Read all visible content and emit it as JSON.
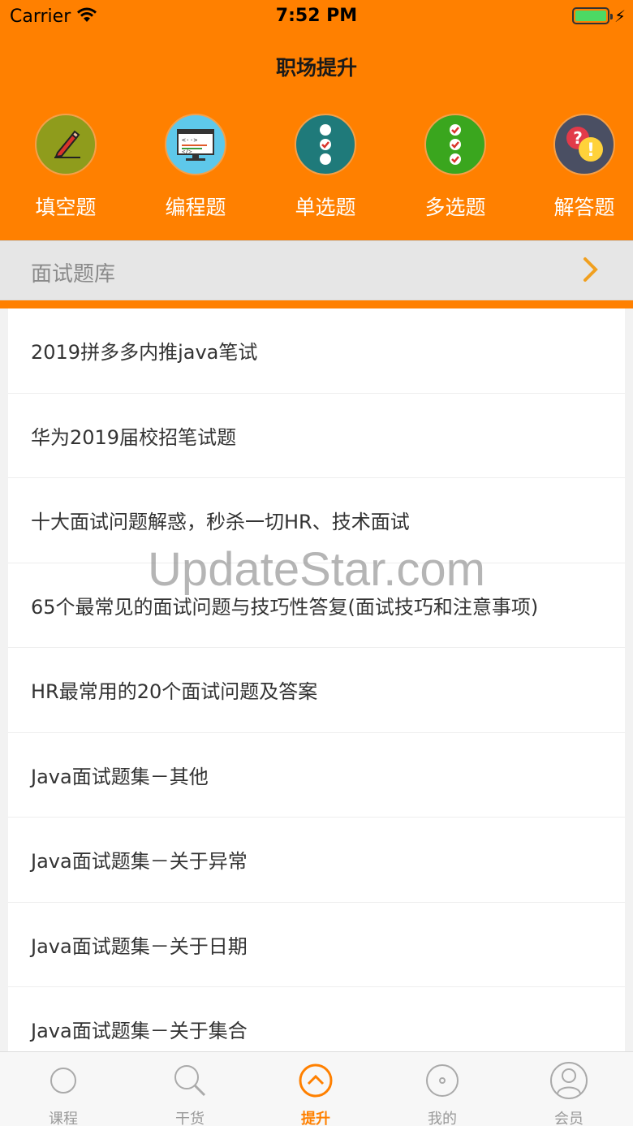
{
  "status": {
    "carrier": "Carrier",
    "time": "7:52 PM"
  },
  "nav": {
    "title": "职场提升"
  },
  "categories": [
    {
      "label": "填空题",
      "icon": "pencil-icon",
      "color": "#8f9c1c"
    },
    {
      "label": "编程题",
      "icon": "monitor-code-icon",
      "color": "#5ec8ea"
    },
    {
      "label": "单选题",
      "icon": "single-choice-icon",
      "color": "#1f7a7a"
    },
    {
      "label": "多选题",
      "icon": "multi-choice-icon",
      "color": "#3aa61e"
    },
    {
      "label": "解答题",
      "icon": "question-exclaim-icon",
      "color": "#4a4f63"
    }
  ],
  "section": {
    "title": "面试题库"
  },
  "list": [
    "2019拼多多内推java笔试",
    "华为2019届校招笔试题",
    "十大面试问题解惑，秒杀一切HR、技术面试",
    "65个最常见的面试问题与技巧性答复(面试技巧和注意事项)",
    "HR最常用的20个面试问题及答案",
    "Java面试题集－其他",
    "Java面试题集－关于异常",
    "Java面试题集－关于日期",
    "Java面试题集－关于集合"
  ],
  "watermark": "UpdateStar.com",
  "tabs": [
    {
      "label": "课程",
      "icon": "circle-icon",
      "active": false
    },
    {
      "label": "干货",
      "icon": "search-icon",
      "active": false
    },
    {
      "label": "提升",
      "icon": "chevron-up-circle-icon",
      "active": true
    },
    {
      "label": "我的",
      "icon": "disc-icon",
      "active": false
    },
    {
      "label": "会员",
      "icon": "user-icon",
      "active": false
    }
  ],
  "colors": {
    "accent": "#ff8000",
    "tab_inactive": "#999999"
  }
}
